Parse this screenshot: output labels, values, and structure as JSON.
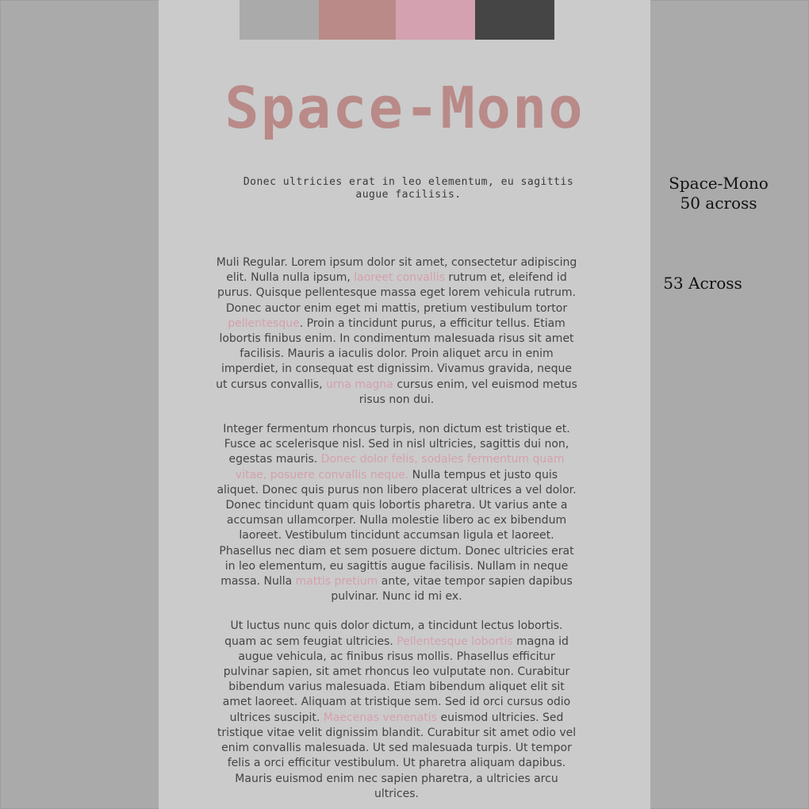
{
  "colors": {
    "background": "#aaaaaa",
    "page": "#cbcbcb",
    "accent": "#b98a88",
    "link": "#d4a0ad",
    "body_text": "#444444"
  },
  "swatches": [
    {
      "color": "#aaaaaa"
    },
    {
      "color": "#b98a88"
    },
    {
      "color": "#d3a1b0"
    },
    {
      "color": "#454545"
    }
  ],
  "title": "Space-Mono",
  "subtitle": "Donec ultricies erat in leo elementum, eu sagittis augue facilisis.",
  "paragraphs": [
    {
      "segments": [
        {
          "text": "Muli Regular. Lorem ipsum dolor sit amet, consectetur adipiscing elit. Nulla nulla ipsum, "
        },
        {
          "text": "laoreet convallis",
          "link": true
        },
        {
          "text": " rutrum et, eleifend id purus. Quisque pellentesque massa eget lorem vehicula rutrum. Donec auctor enim eget mi mattis, pretium vestibulum tortor "
        },
        {
          "text": "pellentesque",
          "link": true
        },
        {
          "text": ". Proin a tincidunt purus, a efficitur tellus. Etiam lobortis finibus enim. In condimentum malesuada risus sit amet facilisis. Mauris a iaculis dolor. Proin aliquet arcu in enim imperdiet, in consequat est dignissim. Vivamus gravida, neque ut cursus convallis, "
        },
        {
          "text": "urna magna",
          "link": true
        },
        {
          "text": " cursus enim, vel euismod metus risus non dui."
        }
      ]
    },
    {
      "segments": [
        {
          "text": "Integer fermentum rhoncus turpis, non dictum est tristique et. Fusce ac scelerisque nisl. Sed in nisl ultricies, sagittis dui non, egestas mauris. "
        },
        {
          "text": "Donec dolor felis, sodales fermentum quam vitae, posuere convallis neque.",
          "link": true
        },
        {
          "text": " Nulla tempus et justo quis aliquet. Donec quis purus non libero placerat ultrices a vel dolor. Donec tincidunt quam quis lobortis pharetra. Ut varius ante a accumsan ullamcorper. Nulla molestie libero ac ex bibendum laoreet. Vestibulum tincidunt accumsan ligula et laoreet. Phasellus nec diam et sem posuere dictum. Donec ultricies erat in leo elementum, eu sagittis augue facilisis. Nullam in neque massa. Nulla "
        },
        {
          "text": "mattis pretium",
          "link": true
        },
        {
          "text": " ante, vitae tempor sapien dapibus pulvinar. Nunc id mi ex."
        }
      ]
    },
    {
      "segments": [
        {
          "text": "Ut luctus nunc quis dolor dictum, a tincidunt lectus lobortis. quam ac sem feugiat ultricies. "
        },
        {
          "text": "Pellentesque lobortis",
          "link": true
        },
        {
          "text": " magna id augue vehicula, ac finibus risus mollis. Phasellus efficitur pulvinar sapien, sit amet rhoncus leo vulputate non. Curabitur bibendum varius malesuada. Etiam bibendum aliquet elit sit amet laoreet. Aliquam at tristique sem. Sed id orci cursus odio ultrices suscipit. "
        },
        {
          "text": "Maecenas venenatis",
          "link": true
        },
        {
          "text": " euismod ultricies. Sed tristique vitae velit dignissim blandit. Curabitur sit amet odio vel enim convallis malesuada. Ut sed malesuada turpis. Ut tempor felis a orci efficitur vestibulum. Ut pharetra aliquam dapibus. Mauris euismod enim nec sapien pharetra, a ultricies arcu ultrices."
        }
      ]
    }
  ],
  "notes": {
    "note1_line1": "Space-Mono",
    "note1_line2": "50 across",
    "note2": "53 Across"
  }
}
